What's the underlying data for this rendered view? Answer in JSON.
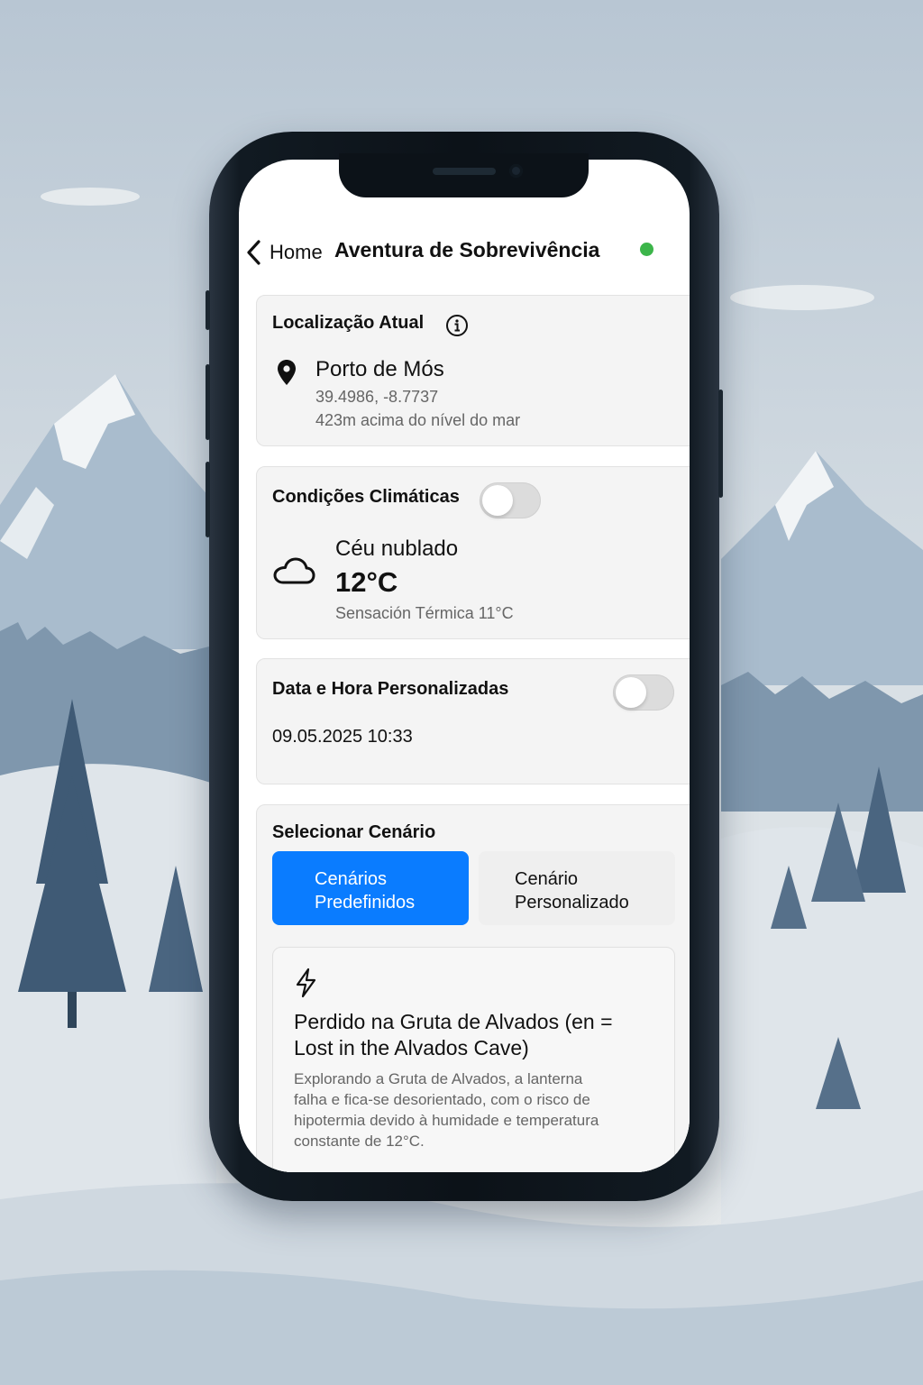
{
  "nav": {
    "back_label": "Home",
    "title": "Aventura de Sobrevivência",
    "status_color": "#3cb54a"
  },
  "location": {
    "title": "Localização Atual",
    "place": "Porto de Mós",
    "coordinates": "39.4986, -8.7737",
    "altitude": "423m acima do nível do mar"
  },
  "weather": {
    "title": "Condições Climáticas",
    "toggle_on": false,
    "condition": "Céu nublado",
    "temperature": "12°C",
    "feels_like": "Sensación Térmica 11°C",
    "icon": "cloud-icon"
  },
  "datetime": {
    "title": "Data e Hora Personalizadas",
    "toggle_on": false,
    "value": "09.05.2025 10:33"
  },
  "scenario": {
    "title": "Selecionar Cenário",
    "tabs": [
      {
        "line1": "Cenários",
        "line2": "Predefinidos",
        "active": true
      },
      {
        "line1": "Cenário",
        "line2": "Personalizado",
        "active": false
      }
    ],
    "card": {
      "icon": "lightning-icon",
      "title_line1": "Perdido na Gruta de Alvados (en =",
      "title_line2": "Lost in the Alvados Cave)",
      "desc_line1": "Explorando a Gruta de Alvados, a lanterna",
      "desc_line2": "falha e fica-se desorientado, com o risco de",
      "desc_line3": "hipotermia devido à humidade e temperatura",
      "desc_line4": "constante de 12°C."
    }
  },
  "colors": {
    "accent": "#0a7cff",
    "card_bg": "#f4f4f4",
    "status_green": "#3cb54a"
  }
}
